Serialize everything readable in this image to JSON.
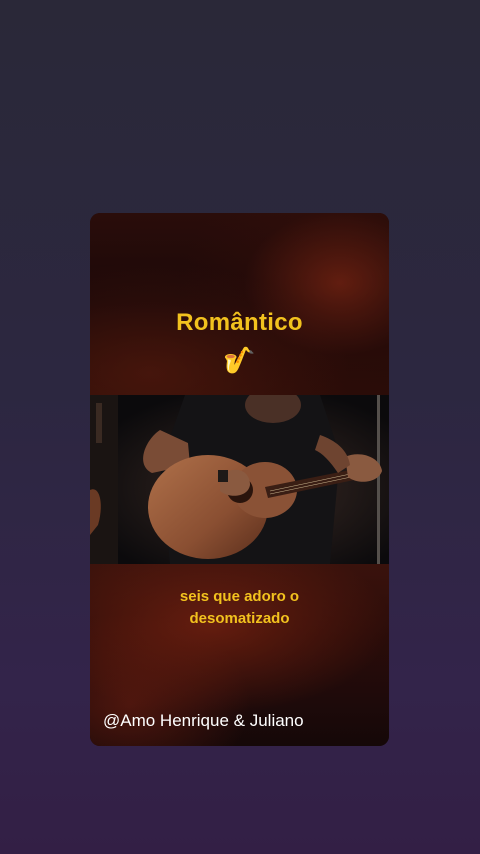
{
  "card": {
    "title": "Romântico",
    "emoji": "🎷",
    "caption_line1": "seis que adoro o",
    "caption_line2": "desomatizado",
    "credit": "@Amo Henrique & Juliano"
  },
  "colors": {
    "title": "#f2c21e",
    "caption": "#f2c21e",
    "credit": "#ffffff",
    "background_top": "#2a2838",
    "background_bottom": "#331f45"
  },
  "video": {
    "subject": "guitarist-playing-acoustic-guitar"
  }
}
